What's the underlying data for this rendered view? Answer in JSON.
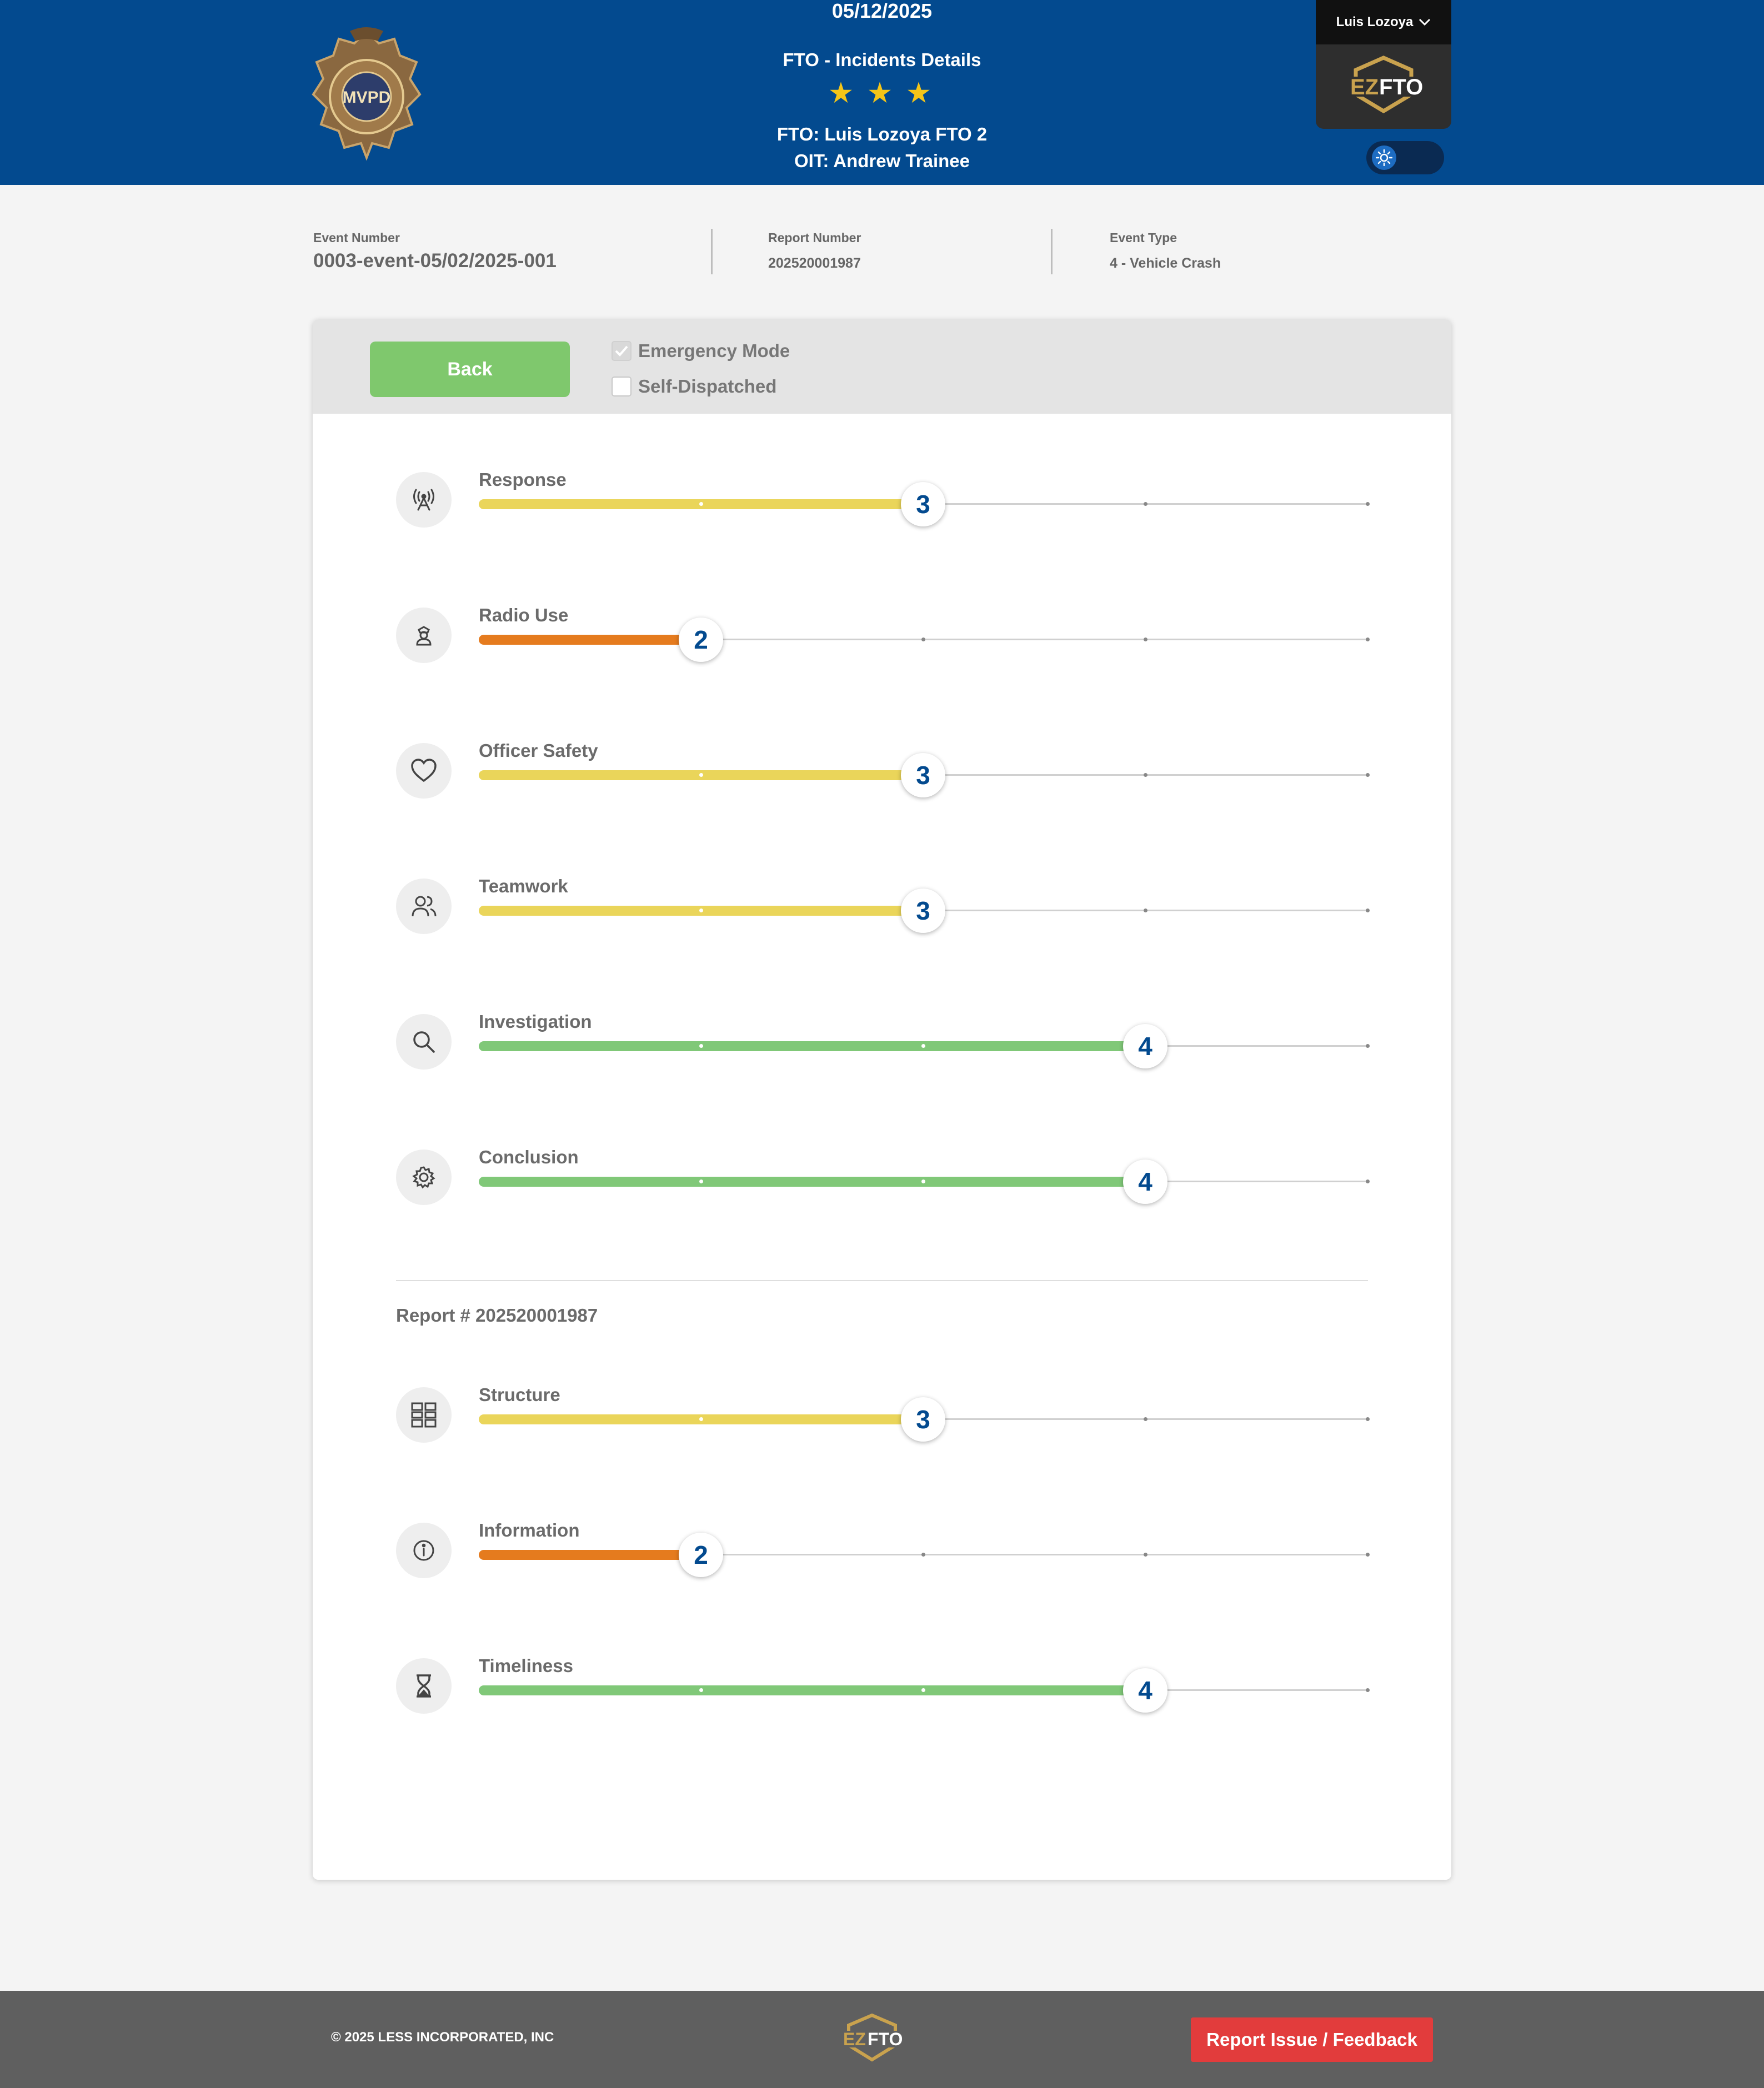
{
  "header": {
    "date": "05/12/2025",
    "title": "FTO - Incidents Details",
    "stars": "★ ★ ★",
    "star_count": 3,
    "fto": "FTO: Luis Lozoya FTO 2",
    "oit": "OIT: Andrew Trainee",
    "badge_icon": "police-badge-logo",
    "badge_text": "MVPD",
    "user_name": "Luis Lozoya",
    "brand_logo": "EZFTO",
    "theme_toggle_icon": "sun-icon"
  },
  "info": {
    "event_number_label": "Event Number",
    "event_number": "0003-event-05/02/2025-001",
    "report_number_label": "Report Number",
    "report_number": "202520001987",
    "event_type_label": "Event Type",
    "event_type": "4 - Vehicle Crash"
  },
  "controls": {
    "back_label": "Back",
    "emergency_label": "Emergency Mode",
    "emergency_checked": true,
    "self_dispatched_label": "Self-Dispatched",
    "self_dispatched_checked": false
  },
  "scale_max": 5,
  "colors": {
    "low": "#e57b1e",
    "mid": "#ead55a",
    "high": "#80c878",
    "brand": "#034a8f",
    "danger": "#e23c3c"
  },
  "criteria": [
    {
      "label": "Response",
      "icon": "antenna-icon",
      "score": 3
    },
    {
      "label": "Radio Use",
      "icon": "officer-icon",
      "score": 2
    },
    {
      "label": "Officer Safety",
      "icon": "heart-icon",
      "score": 3
    },
    {
      "label": "Teamwork",
      "icon": "users-icon",
      "score": 3
    },
    {
      "label": "Investigation",
      "icon": "search-icon",
      "score": 4
    },
    {
      "label": "Conclusion",
      "icon": "gear-icon",
      "score": 4
    }
  ],
  "report_section": {
    "heading": "Report # 202520001987",
    "criteria": [
      {
        "label": "Structure",
        "icon": "grid-icon",
        "score": 3
      },
      {
        "label": "Information",
        "icon": "info-icon",
        "score": 2
      },
      {
        "label": "Timeliness",
        "icon": "hourglass-icon",
        "score": 4
      }
    ]
  },
  "footer": {
    "copyright": "© 2025 LESS INCORPORATED, INC",
    "report_button": "Report Issue / Feedback"
  }
}
